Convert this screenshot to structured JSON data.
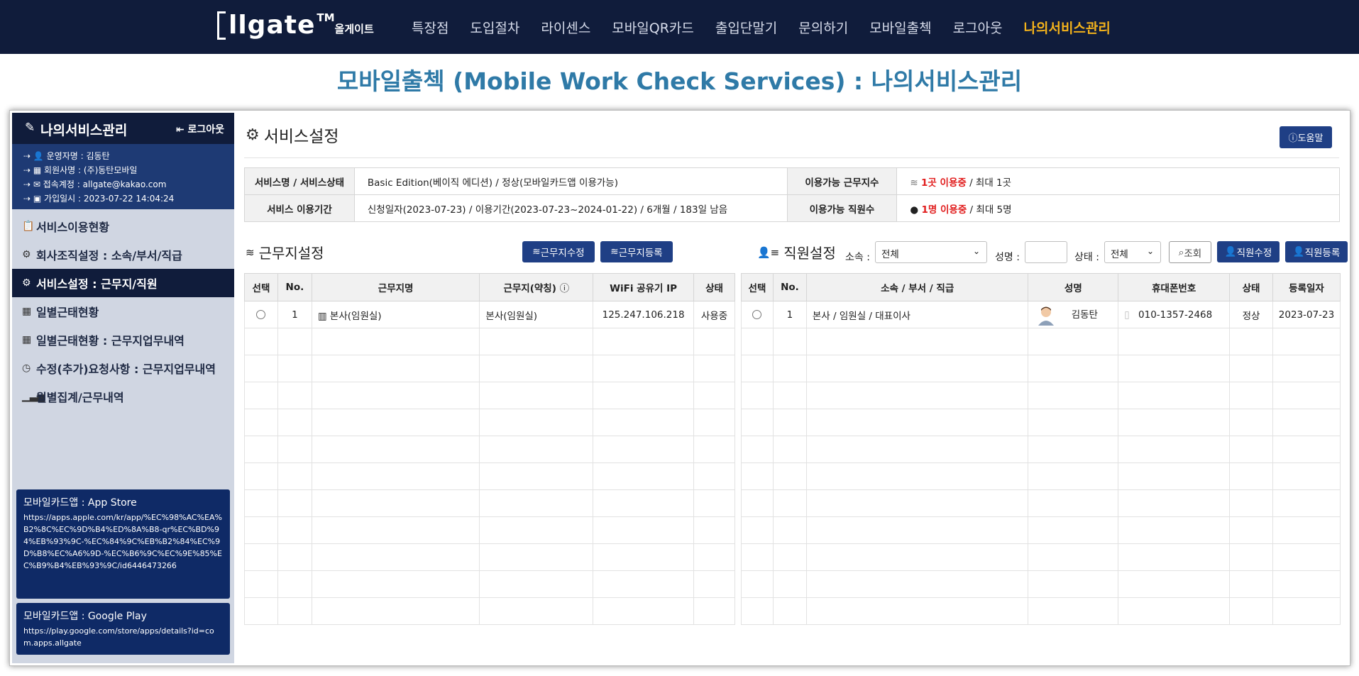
{
  "brand": {
    "logo_text": "llgate",
    "logo_tm": "TM",
    "logo_korean": "올게이트"
  },
  "nav": {
    "items": [
      {
        "label": "특장점"
      },
      {
        "label": "도입절차"
      },
      {
        "label": "라이센스"
      },
      {
        "label": "모바일QR카드"
      },
      {
        "label": "출입단말기"
      },
      {
        "label": "문의하기"
      },
      {
        "label": "모바일출첵"
      },
      {
        "label": "로그아웃"
      },
      {
        "label": "나의서비스관리"
      }
    ],
    "active_color": "#f3b21b"
  },
  "page_title": "모바일출첵 (Mobile Work Check Services) : 나의서비스관리",
  "sidebar": {
    "title": "나의서비스관리",
    "logout_label": "로그아웃",
    "info": [
      "운영자명 : 김동탄",
      "회원사명 : (주)동탄모바일",
      "접속계정 : allgate@kakao.com",
      "가입일시 : 2023-07-22 14:04:24"
    ],
    "menu": [
      {
        "label": "서비스이용현황",
        "icon": "clipboard-icon"
      },
      {
        "label": "회사조직설정 : 소속/부서/직급",
        "icon": "gear-icon"
      },
      {
        "label": "서비스설정 : 근무지/직원",
        "icon": "gear-icon",
        "active": true
      },
      {
        "label": "일별근태현황",
        "icon": "calendar-icon"
      },
      {
        "label": "일별근태현황 : 근무지업무내역",
        "icon": "calendar-icon"
      },
      {
        "label": "수정(추가)요청사항 : 근무지업무내역",
        "icon": "clock-icon"
      },
      {
        "label": "월별집계/근무내역",
        "icon": "bar-chart-icon"
      }
    ],
    "app_store": {
      "title": "모바일카드앱 : App Store",
      "url": "https://apps.apple.com/kr/app/%EC%98%AC%EA%B2%8C%EC%9D%B4%ED%8A%B8-qr%EC%BD%94%EB%93%9C-%EC%84%9C%EB%B2%84%EC%9D%B8%EC%A6%9D-%EC%B6%9C%EC%9E%85%EC%B9%B4%EB%93%9C/id6446473266"
    },
    "google_play": {
      "title": "모바일카드앱 : Google Play",
      "url": "https://play.google.com/store/apps/details?id=com.apps.allgate"
    }
  },
  "service": {
    "title": "서비스설정",
    "help_label": "도움말",
    "info": {
      "name_label": "서비스명 / 서비스상태",
      "name_value": "Basic Edition(베이직 에디션) / 정상(모바일카드앱 이용가능)",
      "workplace_label": "이용가능 근무지수",
      "workplace_used": "1곳 이용중",
      "workplace_max": " / 최대 1곳",
      "period_label": "서비스 이용기간",
      "period_value": "신청일자(2023-07-23) / 이용기간(2023-07-23~2024-01-22) / 6개월 / 183일 남음",
      "staff_label": "이용가능 직원수",
      "staff_used": "1명 이용중",
      "staff_max": " / 최대 5명"
    }
  },
  "workplace": {
    "title": "근무지설정",
    "edit_label": "근무지수정",
    "add_label": "근무지등록",
    "columns": [
      "선택",
      "No.",
      "근무지명",
      "근무지(약칭)",
      "WiFi 공유기 IP",
      "상태"
    ],
    "rows": [
      {
        "no": "1",
        "name": "본사(임원실)",
        "short": "본사(임원실)",
        "ip": "125.247.106.218",
        "status": "사용중"
      }
    ]
  },
  "staff": {
    "title": "직원설정",
    "filter_org_label": "소속 :",
    "filter_org_value": "전체",
    "filter_name_label": "성명 :",
    "filter_name_value": "",
    "filter_status_label": "상태 :",
    "filter_status_value": "전체",
    "search_label": "조회",
    "edit_label": "직원수정",
    "add_label": "직원등록",
    "columns": [
      "선택",
      "No.",
      "소속 / 부서 / 직급",
      "성명",
      "휴대폰번호",
      "상태",
      "등록일자"
    ],
    "rows": [
      {
        "no": "1",
        "org": "본사 / 임원실 / 대표이사",
        "name": "김동탄",
        "phone": "010-1357-2468",
        "status": "정상",
        "date": "2023-07-23"
      }
    ]
  }
}
